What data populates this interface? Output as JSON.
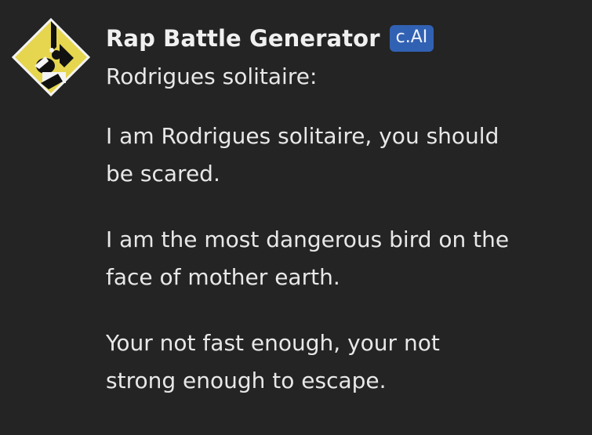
{
  "message": {
    "author": "Rap Battle Generator",
    "badge": "c.AI",
    "speaker_line": "Rodrigues solitaire:",
    "paragraphs": [
      {
        "line1": "I am Rodrigues solitaire, you should",
        "line2": "be scared."
      },
      {
        "line1": "I am the most dangerous bird on the",
        "line2": "face of mother earth."
      },
      {
        "line1": "Your not fast enough, your not",
        "line2": "strong enough to escape."
      }
    ]
  },
  "colors": {
    "background": "#242424",
    "badge_bg": "#3161b3",
    "avatar_yellow": "#e6d64f"
  }
}
